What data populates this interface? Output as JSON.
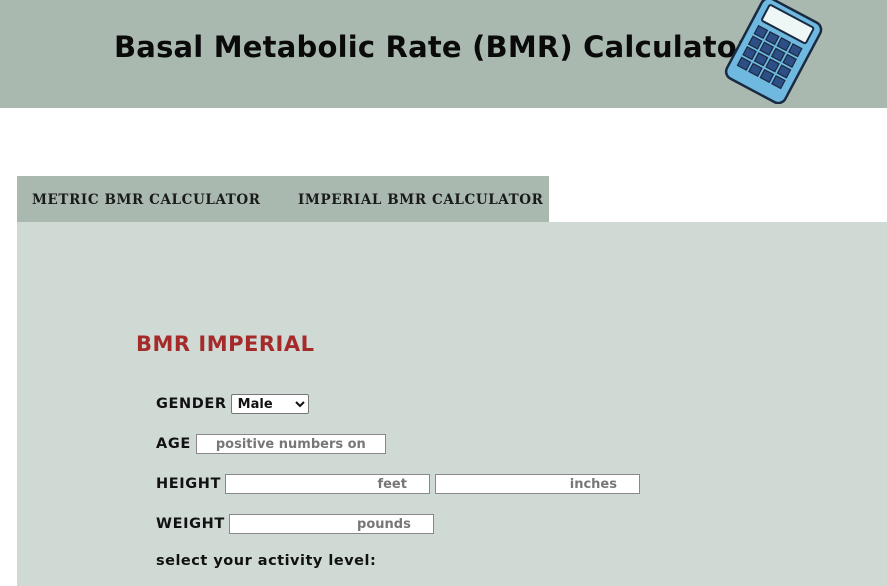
{
  "header": {
    "title": "Basal Metabolic Rate (BMR) Calculator",
    "icon": "calculator-icon"
  },
  "tabs": [
    {
      "label": "METRIC BMR CALCULATOR"
    },
    {
      "label": "IMPERIAL BMR CALCULATOR"
    }
  ],
  "form": {
    "title": "BMR IMPERIAL",
    "gender": {
      "label": "GENDER",
      "selected": "Male"
    },
    "age": {
      "label": "AGE",
      "placeholder": "positive numbers on"
    },
    "height": {
      "label": "HEIGHT",
      "feet_placeholder": "feet",
      "inches_placeholder": "inches"
    },
    "weight": {
      "label": "WEIGHT",
      "placeholder": "pounds"
    },
    "activity_prompt": "select your activity level:"
  },
  "colors": {
    "header_bg": "#a9b9b0",
    "panel_bg": "#d0dad5",
    "title_red": "#a52a2a"
  }
}
